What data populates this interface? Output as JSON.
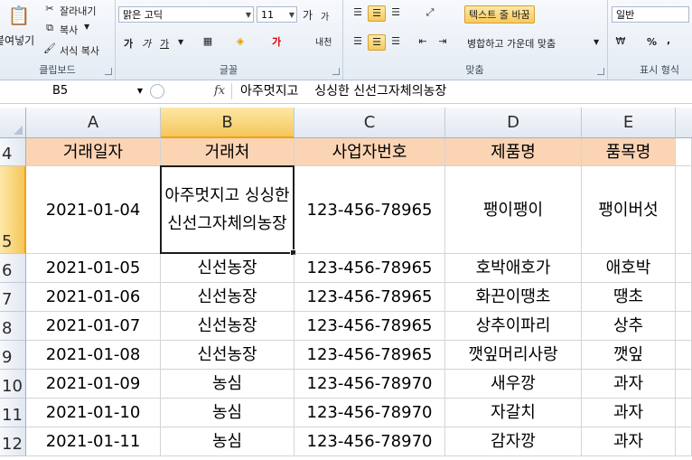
{
  "ribbon": {
    "clipboard": {
      "paste_label": "붙여넣기",
      "cut_label": "잘라내기",
      "copy_label": "복사",
      "format_painter_label": "서식 복사",
      "group_label": "클립보드"
    },
    "font": {
      "font_name": "맑은 고딕",
      "font_size": "11",
      "grow_label": "가",
      "shrink_label": "가",
      "bold_label": "가",
      "italic_label": "가",
      "underline_label": "가",
      "group_label": "글꼴",
      "phonetic_label": "내천"
    },
    "alignment": {
      "wrap_text_label": "텍스트 줄 바꿈",
      "merge_label": "병합하고 가운데 맞춤",
      "group_label": "맞춤"
    },
    "number": {
      "format_value": "일반",
      "percent_label": "%",
      "comma_label": ",",
      "group_label": "표시 형식"
    }
  },
  "formula_bar": {
    "name_box": "B5",
    "fx_label": "fx",
    "content": "아주멋지고    싱싱한 신선그자체의농장"
  },
  "columns": [
    "A",
    "B",
    "C",
    "D",
    "E"
  ],
  "rows": [
    {
      "num": "4",
      "cells": [
        "거래일자",
        "거래처",
        "사업자번호",
        "제품명",
        "품목명"
      ]
    },
    {
      "num": "5",
      "cells": [
        "2021-01-04",
        "아주멋지고 싱싱한 신선그자체의농장",
        "123-456-78965",
        "팽이팽이",
        "팽이버섯"
      ]
    },
    {
      "num": "6",
      "cells": [
        "2021-01-05",
        "신선농장",
        "123-456-78965",
        "호박애호가",
        "애호박"
      ]
    },
    {
      "num": "7",
      "cells": [
        "2021-01-06",
        "신선농장",
        "123-456-78965",
        "화끈이땡초",
        "땡초"
      ]
    },
    {
      "num": "8",
      "cells": [
        "2021-01-07",
        "신선농장",
        "123-456-78965",
        "상추이파리",
        "상추"
      ]
    },
    {
      "num": "9",
      "cells": [
        "2021-01-08",
        "신선농장",
        "123-456-78965",
        "깻잎머리사랑",
        "깻잎"
      ]
    },
    {
      "num": "10",
      "cells": [
        "2021-01-09",
        "농심",
        "123-456-78970",
        "새우깡",
        "과자"
      ]
    },
    {
      "num": "11",
      "cells": [
        "2021-01-10",
        "농심",
        "123-456-78970",
        "자갈치",
        "과자"
      ]
    },
    {
      "num": "12",
      "cells": [
        "2021-01-11",
        "농심",
        "123-456-78970",
        "감자깡",
        "과자"
      ]
    }
  ],
  "colors": {
    "header_fill": "#fbd4b4",
    "selection_accent": "#f5c65a"
  }
}
